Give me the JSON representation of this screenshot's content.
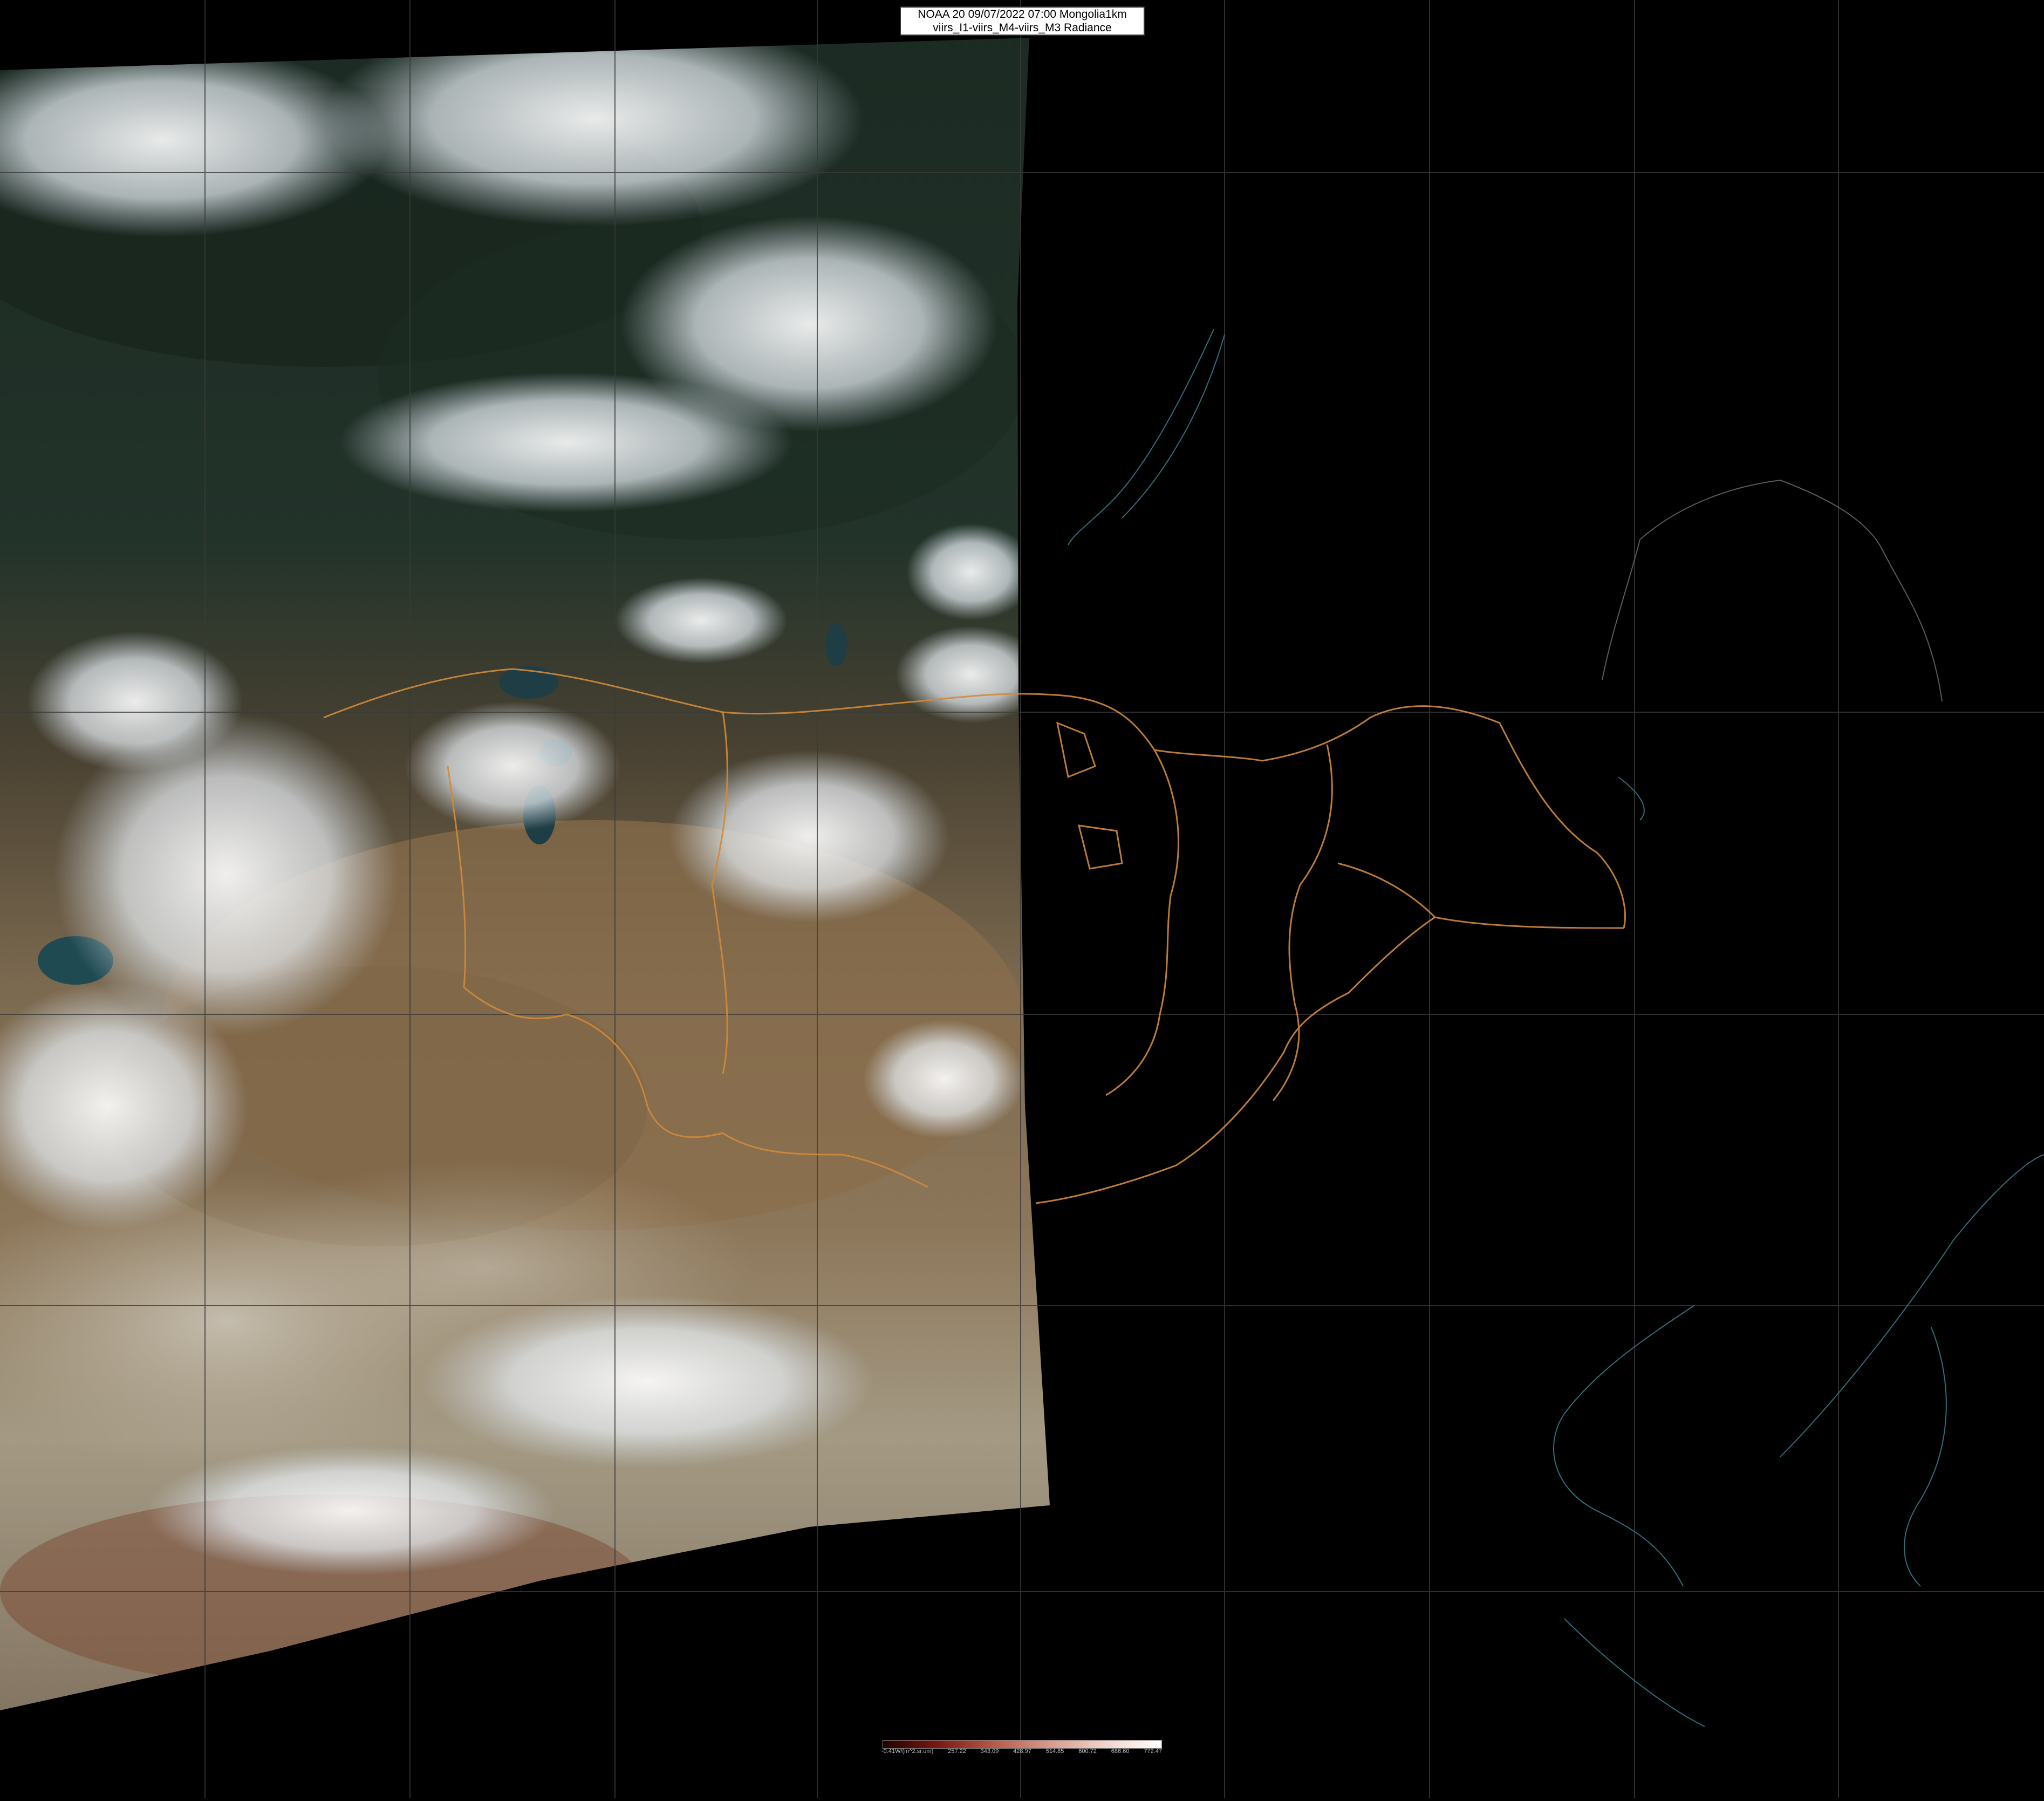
{
  "title": {
    "line1": "NOAA 20 09/07/2022 07:00 Mongolia1km",
    "line2": "viirs_I1-viirs_M4-viirs_M3 Radiance"
  },
  "colors": {
    "background": "#000000",
    "border_lines": "#d08a3c",
    "coastlines": "#2f6f78",
    "grid": "#3a3a3a",
    "cloud": "#e9eef4",
    "desert": "#8f7a5e",
    "vegetation": "#1f3528"
  },
  "legend": {
    "unit_label": "-0.41W/(m^2.sr.um)",
    "ticks": [
      "257.22",
      "343.09",
      "428.97",
      "514.85",
      "600.72",
      "686.60",
      "772.47"
    ],
    "gradient": [
      "#200000",
      "#7a1a12",
      "#b85a48",
      "#d99a8c",
      "#f2d4cc",
      "#ffffff"
    ]
  }
}
